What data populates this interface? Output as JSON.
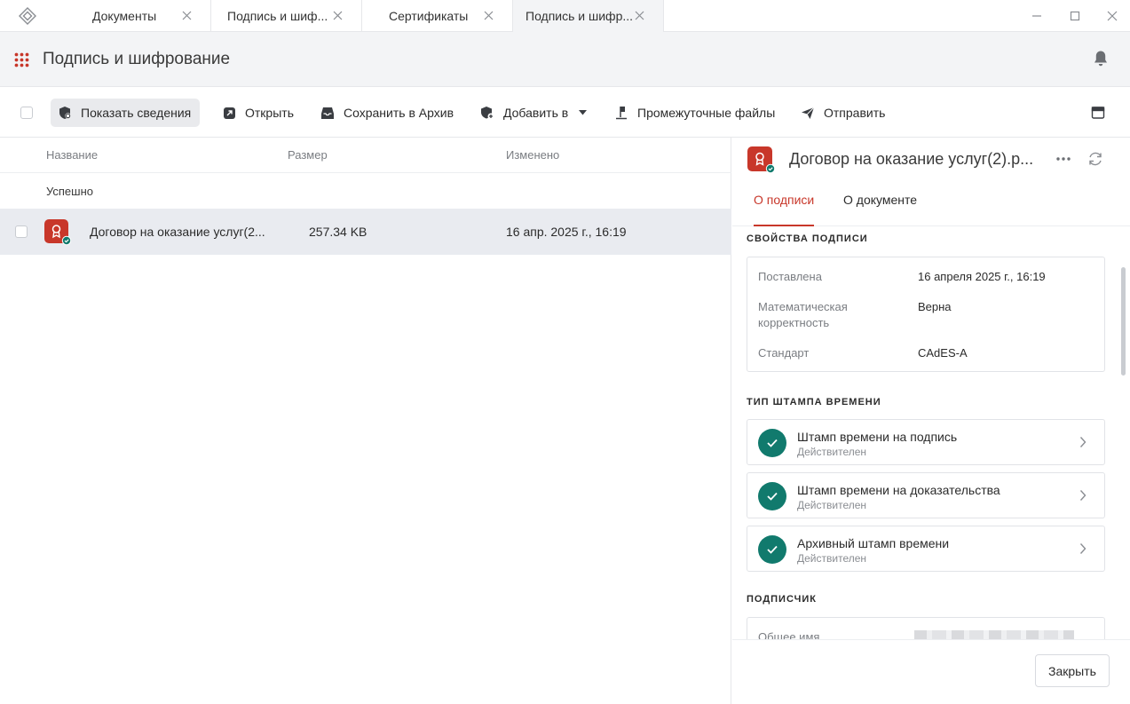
{
  "tabs": [
    {
      "label": "Документы"
    },
    {
      "label": "Подпись и шиф..."
    },
    {
      "label": "Сертификаты"
    },
    {
      "label": "Подпись и шифр..."
    }
  ],
  "header": {
    "title": "Подпись и шифрование"
  },
  "toolbar": {
    "show_details": "Показать сведения",
    "open": "Открыть",
    "save_archive": "Сохранить в Архив",
    "add_to": "Добавить в",
    "intermediate_files": "Промежуточные файлы",
    "send": "Отправить"
  },
  "list": {
    "columns": {
      "name": "Название",
      "size": "Размер",
      "modified": "Изменено"
    },
    "group": "Успешно",
    "rows": [
      {
        "name": "Договор на оказание услуг(2...",
        "size": "257.34 KB",
        "modified": "16 апр. 2025 г., 16:19"
      }
    ]
  },
  "panel": {
    "title": "Договор на оказание услуг(2).р...",
    "tabs": {
      "signature": "О подписи",
      "document": "О документе"
    },
    "signature_props": {
      "title": "свойства подписи",
      "placed_label": "Поставлена",
      "placed_value": "16 апреля 2025 г., 16:19",
      "math_label": "Математическая корректность",
      "math_value": "Верна",
      "standard_label": "Стандарт",
      "standard_value": "CAdES-A"
    },
    "timestamps": {
      "title": "тип штампа времени",
      "items": [
        {
          "name": "Штамп времени на подпись",
          "status": "Действителен"
        },
        {
          "name": "Штамп времени на доказательства",
          "status": "Действителен"
        },
        {
          "name": "Архивный штамп времени",
          "status": "Действителен"
        }
      ]
    },
    "signer": {
      "title": "подписчик",
      "common_name_label": "Общее имя"
    },
    "close": "Закрыть"
  },
  "colors": {
    "accent": "#c8372a",
    "valid": "#117a6d"
  }
}
